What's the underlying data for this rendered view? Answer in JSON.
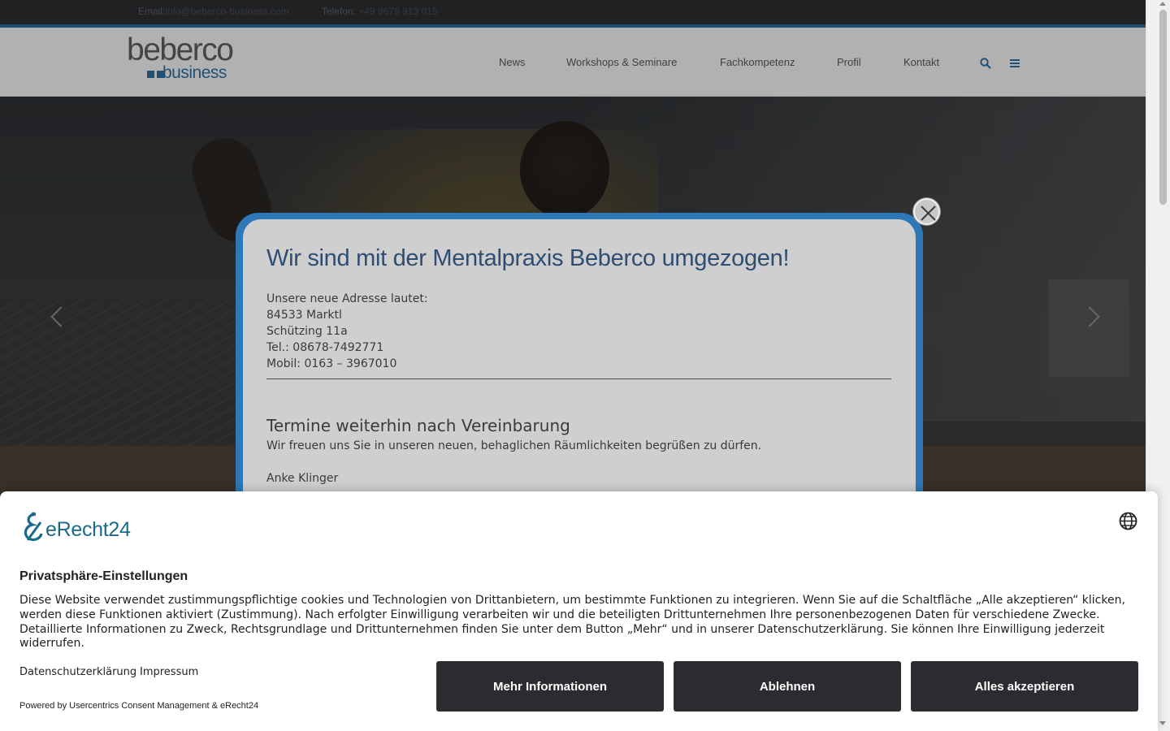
{
  "topbar": {
    "email_label": "Email:",
    "email_value": "info@beberco-business.com",
    "phone_label": "Telefon:",
    "phone_value": "+49 8678 913 015"
  },
  "logo": {
    "main": "beberco",
    "sub": "business"
  },
  "nav": {
    "items": [
      "News",
      "Workshops & Seminare",
      "Fachkompetenz",
      "Profil",
      "Kontakt"
    ],
    "icons": [
      "search-icon",
      "menu-icon"
    ]
  },
  "popup": {
    "title": "Wir sind mit der Mentalpraxis Beberco umgezogen!",
    "address_lines": [
      "Unsere neue Adresse lautet:",
      "84533 Marktl",
      "Schützing 11a",
      "Tel.: 08678-7492771",
      "Mobil: 0163 – 3967010"
    ],
    "subtitle": "Termine weiterhin nach Vereinbarung",
    "paragraph": "Wir freuen uns Sie in unseren neuen, behaglichen Räumlichkeiten begrüßen zu dürfen.",
    "signature": "Anke Klinger"
  },
  "consent": {
    "brand": "eRecht24",
    "heading": "Privatsphäre-Einstellungen",
    "body": "Diese Website verwendet zustimmungspflichtige cookies und Technologien von Drittanbietern, um bestimmte Funktionen zu integrieren. Wenn Sie auf die Schaltfläche „Alle akzeptieren“ klicken, werden diese Funktionen aktiviert (Zustimmung). Nach erfolgter Einwilligung verarbeiten wir und die beteiligten Drittunternehmen Ihre personenbezogenen Daten für verschiedene Zwecke. Detaillierte Informationen zu Zweck, Rechtsgrundlage und Drittunternehmen finden Sie unter dem Button „Mehr“ und in unserer Datenschutzerklärung. Sie können Ihre Einwilligung jederzeit widerrufen.",
    "links": [
      "Datenschutzerklärung",
      "Impressum"
    ],
    "powered_by": "Powered by Usercentrics Consent Management & eRecht24",
    "buttons": {
      "more": "Mehr Informationen",
      "deny": "Ablehnen",
      "accept": "Alles akzeptieren"
    }
  },
  "colors": {
    "accent_blue": "#2f78b7",
    "title_blue": "#2f4d72",
    "button_dark": "#2a2c30",
    "brand_teal": "#1a6a8c"
  }
}
